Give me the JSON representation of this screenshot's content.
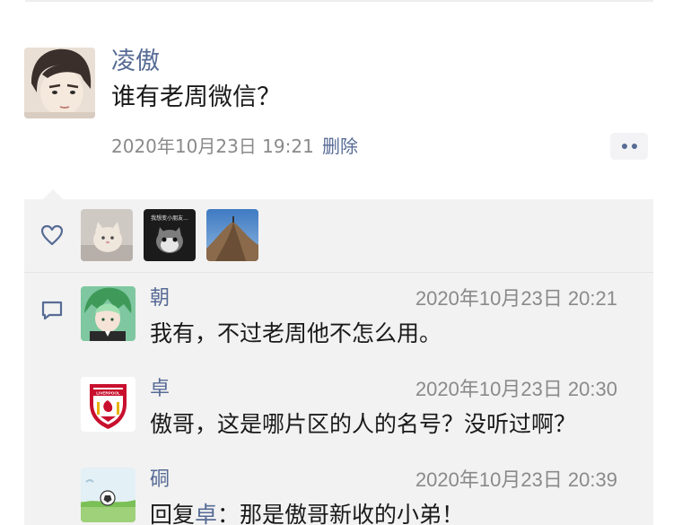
{
  "post": {
    "author": "凌傲",
    "text": "谁有老周微信？",
    "time": "2020年10月23日 19:21",
    "delete_label": "删除"
  },
  "likes": {
    "avatars": [
      "cat-avatar",
      "cat-meme-avatar",
      "mountain-avatar"
    ],
    "meme_caption": "我想变小朋友..."
  },
  "comments": [
    {
      "name": "朝",
      "time": "2020年10月23日 20:21",
      "text": "我有，不过老周他不怎么用。"
    },
    {
      "name": "卓",
      "time": "2020年10月23日 20:30",
      "text": "傲哥，这是哪片区的人的名号？没听过啊？"
    },
    {
      "name": "硐",
      "time": "2020年10月23日 20:39",
      "reply_prefix": "回复",
      "reply_to": "卓",
      "reply_sep": "：",
      "text": "那是傲哥新收的小弟！"
    }
  ],
  "colors": {
    "link": "#576b95",
    "panel": "#f2f2f2",
    "muted": "#8a8a8a"
  }
}
